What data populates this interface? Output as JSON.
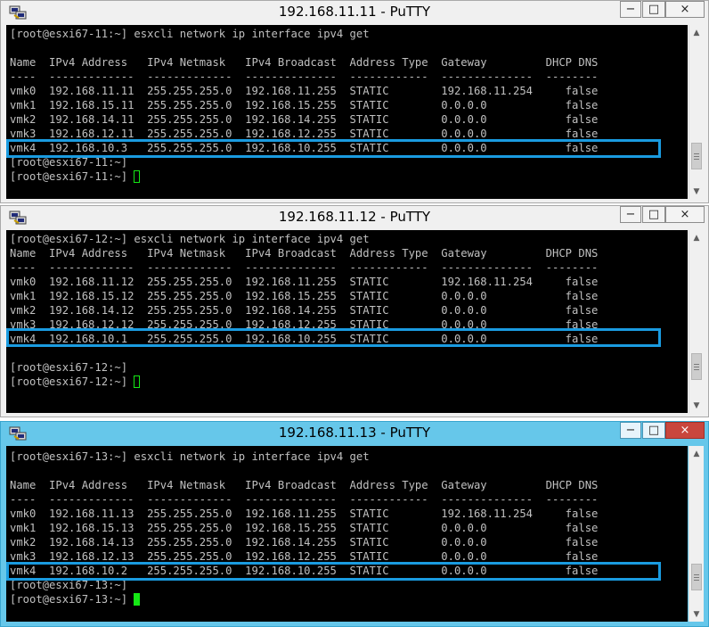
{
  "windows": [
    {
      "title": "192.168.11.11 - PuTTY",
      "lines": [
        "[root@esxi67-11:~] esxcli network ip interface ipv4 get",
        "",
        "Name  IPv4 Address   IPv4 Netmask   IPv4 Broadcast  Address Type  Gateway         DHCP DNS",
        "----  -------------  -------------  --------------  ------------  --------------  --------",
        "vmk0  192.168.11.11  255.255.255.0  192.168.11.255  STATIC        192.168.11.254     false",
        "vmk1  192.168.15.11  255.255.255.0  192.168.15.255  STATIC        0.0.0.0            false",
        "vmk2  192.168.14.11  255.255.255.0  192.168.14.255  STATIC        0.0.0.0            false",
        "vmk3  192.168.12.11  255.255.255.0  192.168.12.255  STATIC        0.0.0.0            false",
        "vmk4  192.168.10.3   255.255.255.0  192.168.10.255  STATIC        0.0.0.0            false",
        "[root@esxi67-11:~]",
        "[root@esxi67-11:~] "
      ]
    },
    {
      "title": "192.168.11.12 - PuTTY",
      "lines": [
        "[root@esxi67-12:~] esxcli network ip interface ipv4 get",
        "Name  IPv4 Address   IPv4 Netmask   IPv4 Broadcast  Address Type  Gateway         DHCP DNS",
        "----  -------------  -------------  --------------  ------------  --------------  --------",
        "vmk0  192.168.11.12  255.255.255.0  192.168.11.255  STATIC        192.168.11.254     false",
        "vmk1  192.168.15.12  255.255.255.0  192.168.15.255  STATIC        0.0.0.0            false",
        "vmk2  192.168.14.12  255.255.255.0  192.168.14.255  STATIC        0.0.0.0            false",
        "vmk3  192.168.12.12  255.255.255.0  192.168.12.255  STATIC        0.0.0.0            false",
        "vmk4  192.168.10.1   255.255.255.0  192.168.10.255  STATIC        0.0.0.0            false",
        "",
        "[root@esxi67-12:~]",
        "[root@esxi67-12:~] "
      ]
    },
    {
      "title": "192.168.11.13 - PuTTY",
      "lines": [
        "[root@esxi67-13:~] esxcli network ip interface ipv4 get",
        "",
        "Name  IPv4 Address   IPv4 Netmask   IPv4 Broadcast  Address Type  Gateway         DHCP DNS",
        "----  -------------  -------------  --------------  ------------  --------------  --------",
        "vmk0  192.168.11.13  255.255.255.0  192.168.11.255  STATIC        192.168.11.254     false",
        "vmk1  192.168.15.13  255.255.255.0  192.168.15.255  STATIC        0.0.0.0            false",
        "vmk2  192.168.14.13  255.255.255.0  192.168.14.255  STATIC        0.0.0.0            false",
        "vmk3  192.168.12.13  255.255.255.0  192.168.12.255  STATIC        0.0.0.0            false",
        "vmk4  192.168.10.2   255.255.255.0  192.168.10.255  STATIC        0.0.0.0            false",
        "[root@esxi67-13:~]",
        "[root@esxi67-13:~] "
      ]
    }
  ],
  "controls": {
    "minimize": "−",
    "maximize": "□",
    "close": "×"
  },
  "icons": {
    "app": "putty-icon",
    "scroll_up": "▲",
    "scroll_down": "▼"
  },
  "colors": {
    "highlight": "#1a9be0",
    "terminal_bg": "#000000",
    "terminal_text": "#c0c0c0",
    "cursor": "#15e815",
    "active_title": "#66c7ea"
  }
}
